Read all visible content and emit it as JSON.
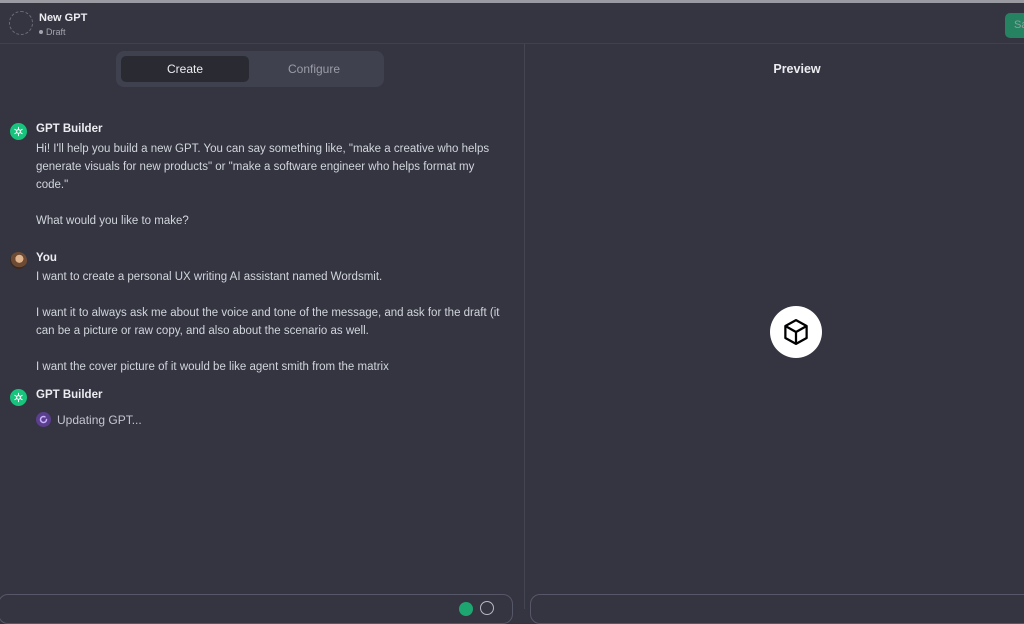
{
  "header": {
    "title": "New GPT",
    "status": "Draft",
    "save_label": "Save"
  },
  "tabs": [
    {
      "label": "Create",
      "active": true
    },
    {
      "label": "Configure",
      "active": false
    }
  ],
  "messages": [
    {
      "author": "GPT Builder",
      "paragraphs": [
        "Hi! I'll help you build a new GPT. You can say something like, \"make a creative who helps generate visuals for new products\" or \"make a software engineer who helps format my code.\"",
        "What would you like to make?"
      ]
    },
    {
      "author": "You",
      "paragraphs": [
        "I want to create a personal UX writing AI assistant named Wordsmit.",
        "I want it to always ask me about the voice and tone of the message, and ask for the draft (it can be a picture or raw copy, and also about the scenario as well.",
        "I want the cover picture of it would be like agent smith from the matrix"
      ]
    },
    {
      "author": "GPT Builder",
      "status": "Updating GPT..."
    }
  ],
  "preview": {
    "title": "Preview",
    "icon": "cube-icon"
  },
  "colors": {
    "background": "#343541",
    "accent": "#19c37d",
    "tab_bar": "#40414f"
  }
}
